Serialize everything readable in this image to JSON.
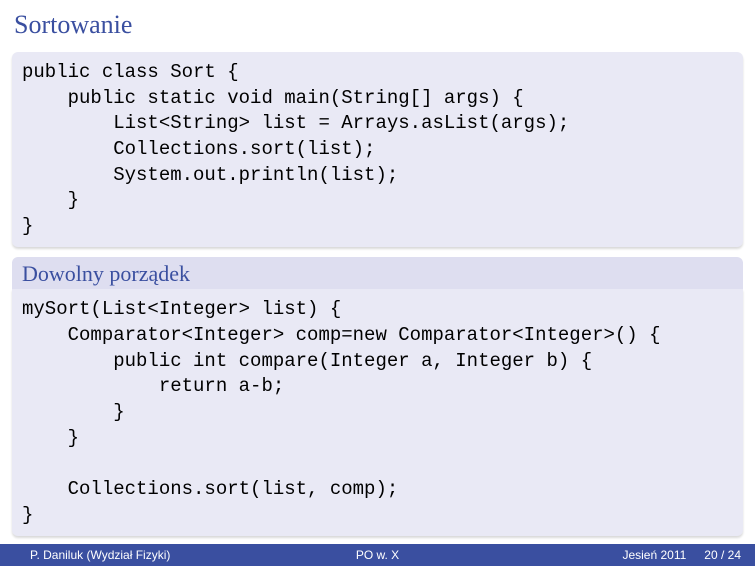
{
  "title": "Sortowanie",
  "code1": "public class Sort {\n    public static void main(String[] args) {\n        List<String> list = Arrays.asList(args);\n        Collections.sort(list);\n        System.out.println(list);\n    }\n}",
  "section2_title": "Dowolny porządek",
  "code2": "mySort(List<Integer> list) {\n    Comparator<Integer> comp=new Comparator<Integer>() {\n        public int compare(Integer a, Integer b) {\n            return a-b;\n        }\n    }\n\n    Collections.sort(list, comp);\n}",
  "footer": {
    "author": "P. Daniluk (Wydział Fizyki)",
    "center": "PO w. X",
    "term": "Jesień 2011",
    "page": "20 / 24"
  }
}
